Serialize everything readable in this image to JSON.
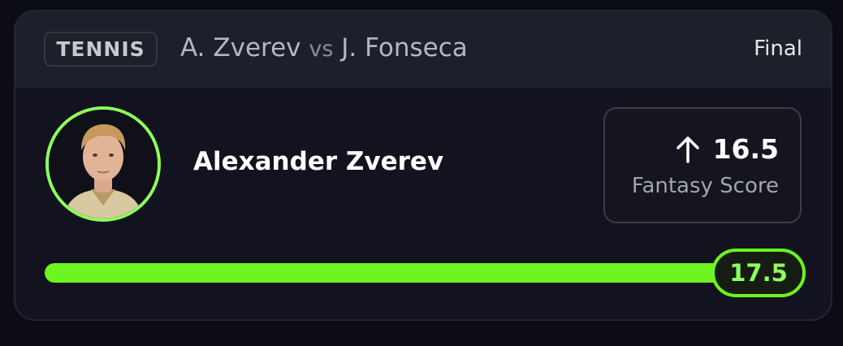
{
  "header": {
    "sport": "TENNIS",
    "player_a": "A. Zverev",
    "vs": "vs",
    "player_b": "J. Fonseca",
    "status": "Final"
  },
  "player": {
    "name": "Alexander Zverev",
    "avatar_ring_color": "#8eff5c"
  },
  "score": {
    "direction_icon": "arrow-up-icon",
    "value": "16.5",
    "label": "Fantasy Score"
  },
  "progress": {
    "line_value": "17.5",
    "fill_fraction": 0.943,
    "fill_color": "#6cf520"
  }
}
